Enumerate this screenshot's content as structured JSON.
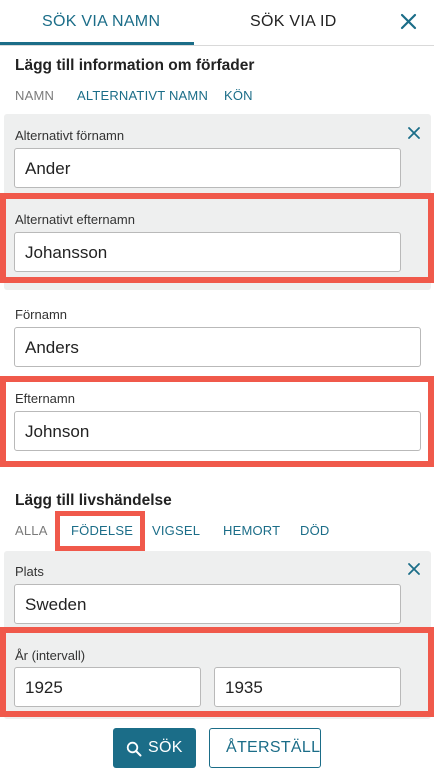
{
  "tabs": {
    "by_name": "SÖK VIA NAMN",
    "by_id": "SÖK VIA ID"
  },
  "ancestor_section": {
    "title": "Lägg till information om förfader",
    "subtabs": [
      "NAMN",
      "ALTERNATIVT NAMN",
      "KÖN"
    ]
  },
  "alternative_name_panel": {
    "first_name_label": "Alternativt förnamn",
    "first_name_value": "Ander",
    "last_name_label": "Alternativt efternamn",
    "last_name_value": "Johansson"
  },
  "name_fields": {
    "first_name_label": "Förnamn",
    "first_name_value": "Anders",
    "last_name_label": "Efternamn",
    "last_name_value": "Johnson"
  },
  "life_event_section": {
    "title": "Lägg till livshändelse",
    "subtabs": [
      "ALLA",
      "FÖDELSE",
      "VIGSEL",
      "HEMORT",
      "DÖD"
    ]
  },
  "birth_panel": {
    "place_label": "Plats",
    "place_value": "Sweden",
    "year_label": "År (intervall)",
    "year_from": "1925",
    "year_to": "1935"
  },
  "buttons": {
    "search": "SÖK",
    "reset": "ÅTERSTÄLL"
  },
  "colors": {
    "accent": "#1b6d88",
    "highlight": "#f0594b",
    "panel_bg": "#eeefef"
  }
}
